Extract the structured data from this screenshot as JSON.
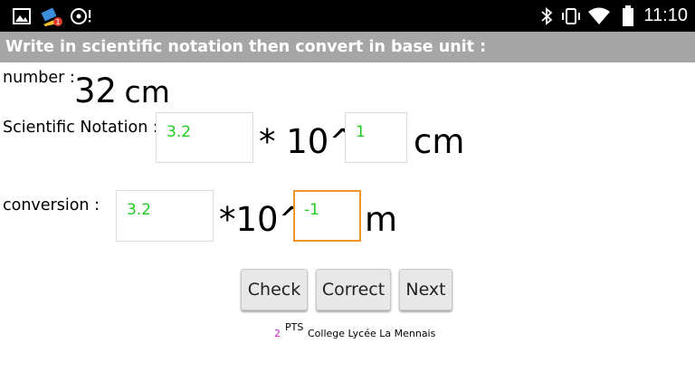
{
  "status_bar": {
    "icons_left": [
      "image-icon",
      "broom-notification-icon",
      "disc-alert-icon"
    ],
    "icons_right": [
      "bluetooth-icon",
      "vibrate-icon",
      "wifi-icon",
      "battery-icon"
    ],
    "time": "11:10"
  },
  "header": {
    "title": "Write in scientific notation then convert in base unit :"
  },
  "number": {
    "label": "number :",
    "value": "32",
    "unit": "cm"
  },
  "scientific": {
    "label": "Scientific Notation :",
    "mantissa": "3.2",
    "times_ten": "* 10^",
    "exponent": "1",
    "unit": "cm"
  },
  "conversion": {
    "label": "conversion :",
    "mantissa": "3.2",
    "times_ten": "*10^",
    "exponent": "-1",
    "unit": "m"
  },
  "buttons": {
    "check": "Check",
    "correct": "Correct",
    "next": "Next"
  },
  "footer": {
    "points": "2",
    "pts_label": "PTS",
    "school": "College Lycée La Mennais"
  },
  "colors": {
    "input_text": "#22cc22",
    "focus_border": "#f0962d",
    "points": "#d026d0",
    "title_bar": "#a6a6a6"
  }
}
